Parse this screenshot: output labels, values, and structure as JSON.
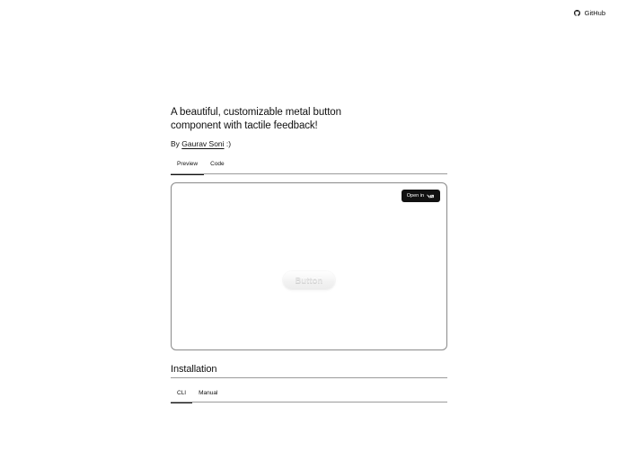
{
  "header": {
    "github_label": "GitHub",
    "github_icon": "github-icon"
  },
  "hero": {
    "headline": "A beautiful, customizable metal button component with tactile feedback!",
    "by_prefix": "By",
    "author": "Gaurav Soni",
    "by_suffix": ":)"
  },
  "preview_tabs": [
    {
      "label": "Preview",
      "active": true
    },
    {
      "label": "Code",
      "active": false
    }
  ],
  "preview": {
    "open_in_label": "Open in",
    "open_in_icon": "v0-logo-icon",
    "demo_button_label": "Button"
  },
  "installation": {
    "title": "Installation",
    "tabs": [
      {
        "label": "CLI",
        "active": true
      },
      {
        "label": "Manual",
        "active": false
      }
    ]
  }
}
